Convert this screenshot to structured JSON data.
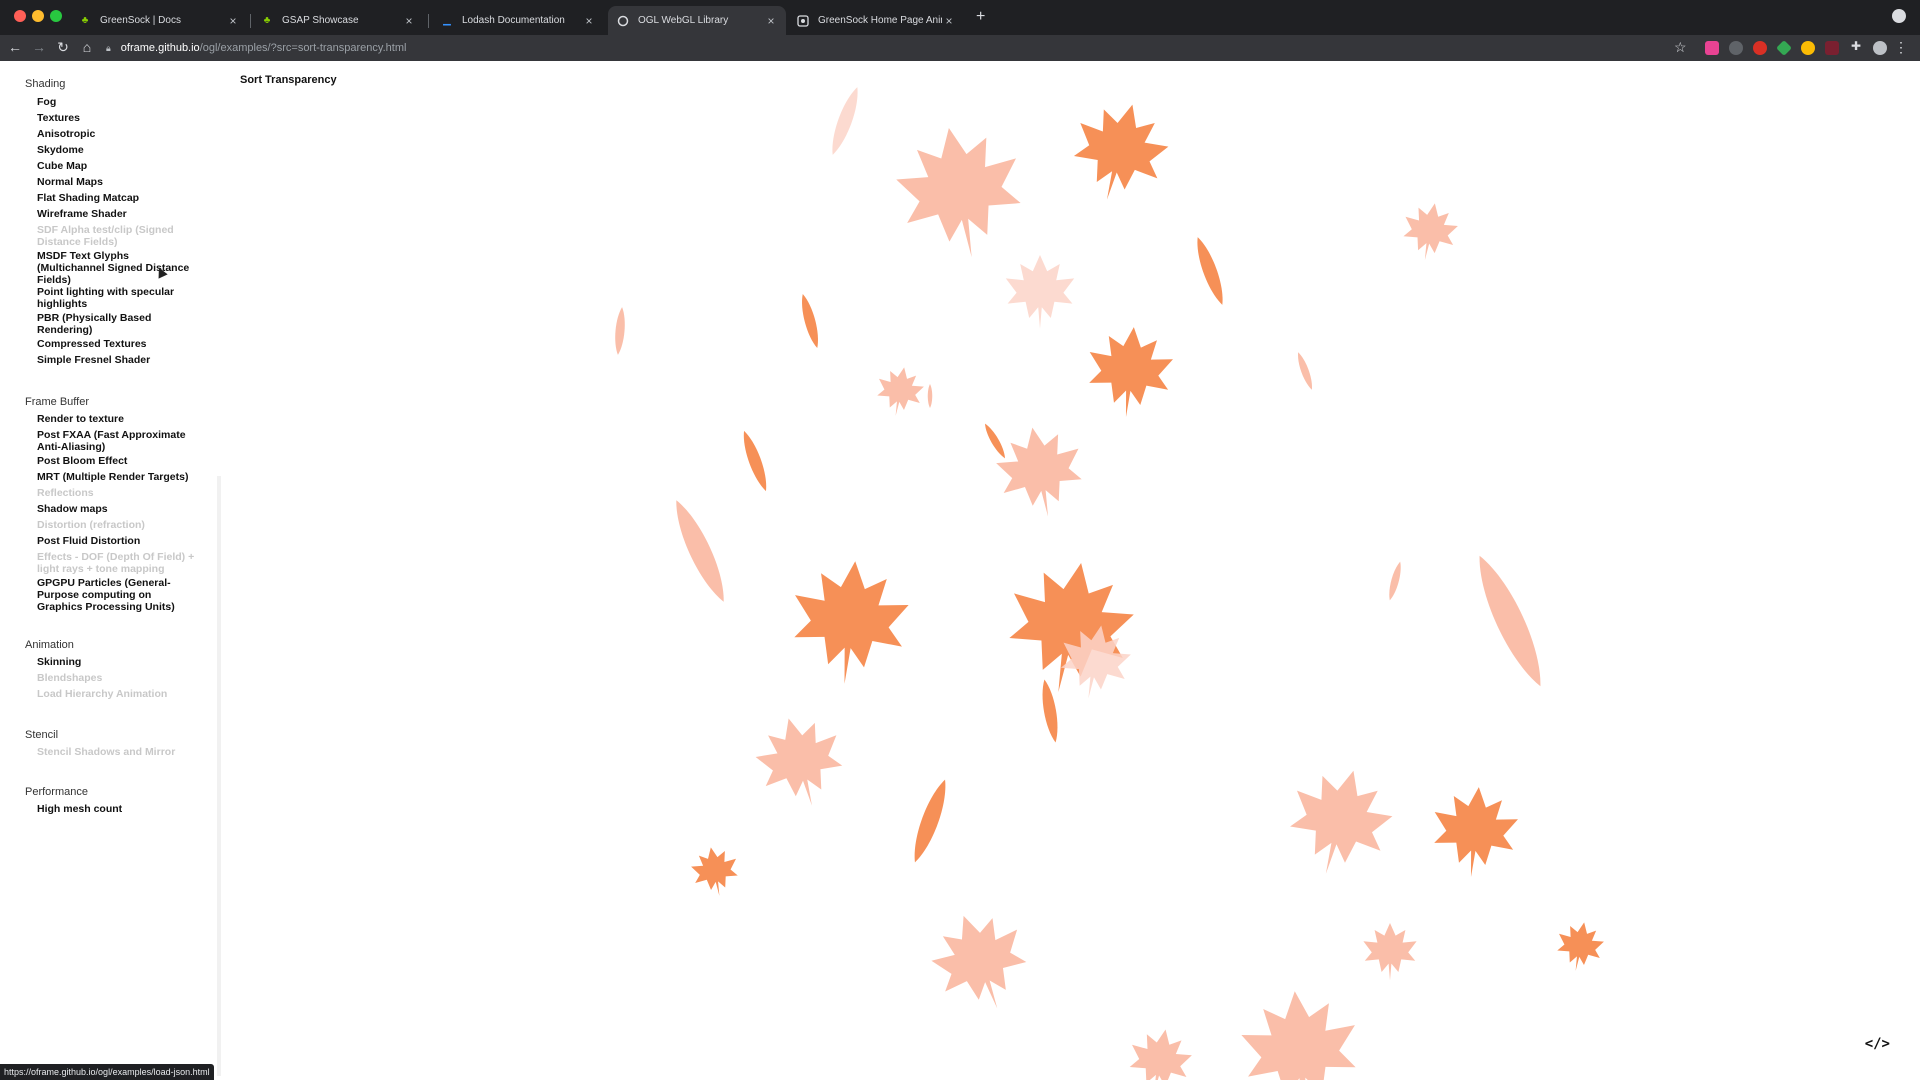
{
  "browser": {
    "tabs": [
      {
        "title": "GreenSock | Docs",
        "icon": "greensock-favicon",
        "active": false
      },
      {
        "title": "GSAP Showcase",
        "icon": "greensock-favicon",
        "active": false
      },
      {
        "title": "Lodash Documentation",
        "icon": "lodash-favicon",
        "active": false
      },
      {
        "title": "OGL WebGL Library",
        "icon": "ogl-favicon",
        "active": true
      },
      {
        "title": "GreenSock Home Page Animat",
        "icon": "greensock-home-favicon",
        "active": false
      }
    ],
    "url_host": "oframe.github.io",
    "url_path": "/ogl/examples/?src=sort-transparency.html",
    "status_url": "https://oframe.github.io/ogl/examples/load-json.html"
  },
  "page": {
    "title": "Sort Transparency",
    "code_button": "</>"
  },
  "sidebar": {
    "sections": [
      {
        "title": "Shading",
        "items": [
          {
            "label": "Fog",
            "disabled": false
          },
          {
            "label": "Textures",
            "disabled": false
          },
          {
            "label": "Anisotropic",
            "disabled": false
          },
          {
            "label": "Skydome",
            "disabled": false
          },
          {
            "label": "Cube Map",
            "disabled": false
          },
          {
            "label": "Normal Maps",
            "disabled": false
          },
          {
            "label": "Flat Shading Matcap",
            "disabled": false
          },
          {
            "label": "Wireframe Shader",
            "disabled": false
          },
          {
            "label": "SDF Alpha test/clip (Signed Distance Fields)",
            "disabled": true
          },
          {
            "label": "MSDF Text Glyphs (Multichannel Signed Distance Fields)",
            "disabled": false
          },
          {
            "label": "Point lighting with specular highlights",
            "disabled": false
          },
          {
            "label": "PBR (Physically Based Rendering)",
            "disabled": false
          },
          {
            "label": "Compressed Textures",
            "disabled": false
          },
          {
            "label": "Simple Fresnel Shader",
            "disabled": false
          }
        ]
      },
      {
        "title": "Frame Buffer",
        "items": [
          {
            "label": "Render to texture",
            "disabled": false
          },
          {
            "label": "Post FXAA (Fast Approximate Anti-Aliasing)",
            "disabled": false
          },
          {
            "label": "Post Bloom Effect",
            "disabled": false
          },
          {
            "label": "MRT (Multiple Render Targets)",
            "disabled": false
          },
          {
            "label": "Reflections",
            "disabled": true
          },
          {
            "label": "Shadow maps",
            "disabled": false
          },
          {
            "label": "Distortion (refraction)",
            "disabled": true
          },
          {
            "label": "Post Fluid Distortion",
            "disabled": false
          },
          {
            "label": "Effects - DOF (Depth Of Field) + light rays + tone mapping",
            "disabled": true
          },
          {
            "label": "GPGPU Particles (General-Purpose computing on Graphics Processing Units)",
            "disabled": false
          }
        ]
      },
      {
        "title": "Animation",
        "items": [
          {
            "label": "Skinning",
            "disabled": false
          },
          {
            "label": "Blendshapes",
            "disabled": true
          },
          {
            "label": "Load Hierarchy Animation",
            "disabled": true
          }
        ]
      },
      {
        "title": "Stencil",
        "items": [
          {
            "label": "Stencil Shadows and Mirror",
            "disabled": true
          }
        ]
      },
      {
        "title": "Performance",
        "items": [
          {
            "label": "High mesh count",
            "disabled": false
          }
        ]
      }
    ]
  },
  "colors": {
    "leaf_orange": "#f57d3a",
    "leaf_light": "#f9b39a",
    "leaf_pale": "#fbd3c8"
  }
}
